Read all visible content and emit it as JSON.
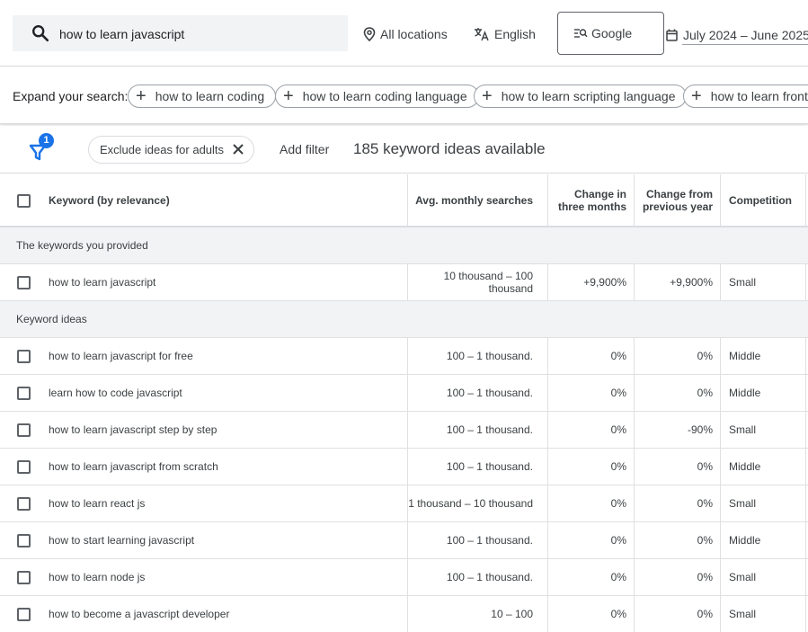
{
  "search": {
    "query": "how to learn javascript"
  },
  "targeting": {
    "location": "All locations",
    "language": "English",
    "network": "Google",
    "date_range": "July 2024 – June 2025"
  },
  "expand": {
    "label": "Expand your search:",
    "chips": [
      "how to learn coding",
      "how to learn coding language",
      "how to learn scripting language",
      "how to learn front end"
    ]
  },
  "filters": {
    "badge_count": "1",
    "active_filter": "Exclude ideas for adults",
    "add_filter_label": "Add filter",
    "ideas_available": "185 keyword ideas available"
  },
  "table": {
    "headers": {
      "keyword": "Keyword (by relevance)",
      "avg_searches": "Avg. monthly searches",
      "change_3m": "Change in three months",
      "change_yoy": "Change from previous year",
      "competition": "Competition"
    },
    "provided_group_label": "The keywords you provided",
    "provided_rows": [
      {
        "keyword": "how to learn javascript",
        "avg": "10 thousand – 100 thousand",
        "ch3": "+9,900%",
        "chy": "+9,900%",
        "comp": "Small"
      }
    ],
    "ideas_group_label": "Keyword ideas",
    "idea_rows": [
      {
        "keyword": "how to learn javascript for free",
        "avg": "100 – 1 thousand.",
        "ch3": "0%",
        "chy": "0%",
        "comp": "Middle"
      },
      {
        "keyword": "learn how to code javascript",
        "avg": "100 – 1 thousand.",
        "ch3": "0%",
        "chy": "0%",
        "comp": "Middle"
      },
      {
        "keyword": "how to learn javascript step by step",
        "avg": "100 – 1 thousand.",
        "ch3": "0%",
        "chy": "-90%",
        "comp": "Small"
      },
      {
        "keyword": "how to learn javascript from scratch",
        "avg": "100 – 1 thousand.",
        "ch3": "0%",
        "chy": "0%",
        "comp": "Middle"
      },
      {
        "keyword": "how to learn react js",
        "avg": "1 thousand – 10 thousand",
        "ch3": "0%",
        "chy": "0%",
        "comp": "Small"
      },
      {
        "keyword": "how to start learning javascript",
        "avg": "100 – 1 thousand.",
        "ch3": "0%",
        "chy": "0%",
        "comp": "Middle"
      },
      {
        "keyword": "how to learn node js",
        "avg": "100 – 1 thousand.",
        "ch3": "0%",
        "chy": "0%",
        "comp": "Small"
      },
      {
        "keyword": "how to become a javascript developer",
        "avg": "10 – 100",
        "ch3": "0%",
        "chy": "0%",
        "comp": "Small"
      }
    ]
  },
  "colors": {
    "accent": "#1a73e8",
    "group_bg": "#f1f3f4",
    "search_bg": "#f1f3f4"
  }
}
